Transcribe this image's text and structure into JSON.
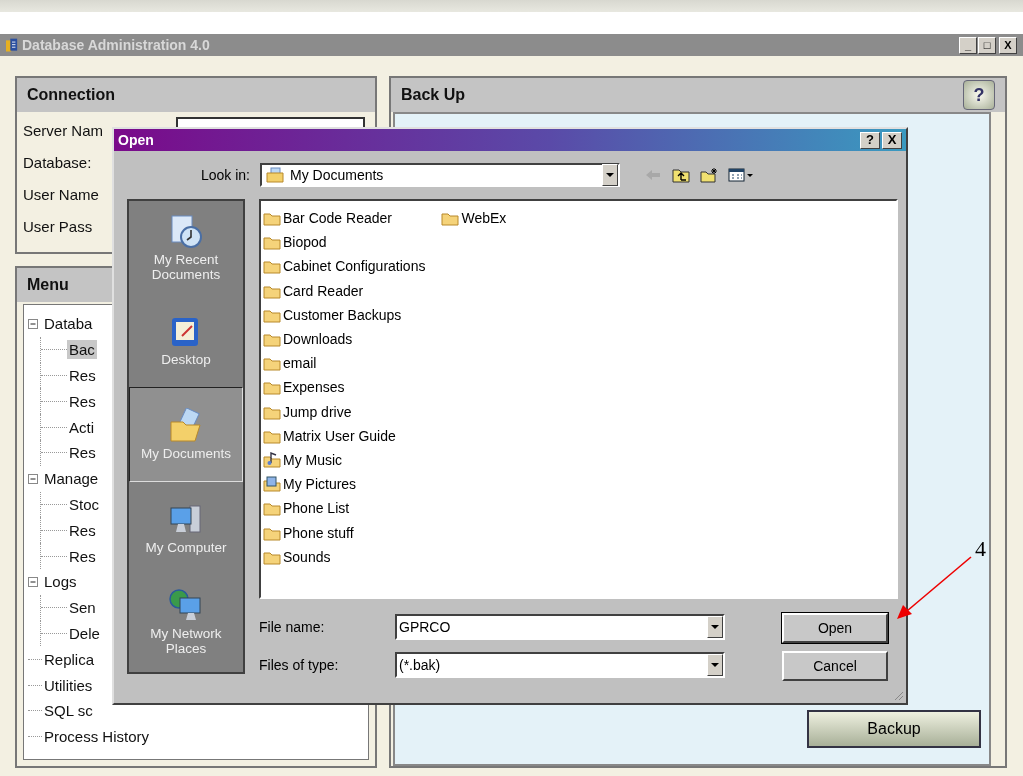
{
  "window": {
    "title": "Database Administration 4.0",
    "controls": [
      "_",
      "□",
      "X"
    ]
  },
  "connection": {
    "title": "Connection",
    "labels": [
      "Server Nam",
      "Database:",
      "User Name",
      "User Pass"
    ]
  },
  "menu": {
    "title": "Menu",
    "tree": [
      {
        "label": "Databa",
        "expanded": true,
        "selected": false,
        "children": [
          {
            "label": "Bac",
            "selected": true
          },
          {
            "label": "Res",
            "selected": false
          },
          {
            "label": "Res",
            "selected": false
          },
          {
            "label": "Acti",
            "selected": false
          },
          {
            "label": "Res",
            "selected": false
          }
        ]
      },
      {
        "label": "Manage",
        "expanded": true,
        "selected": false,
        "children": [
          {
            "label": "Stoc",
            "selected": false
          },
          {
            "label": "Res",
            "selected": false
          },
          {
            "label": "Res",
            "selected": false
          }
        ]
      },
      {
        "label": "Logs",
        "expanded": true,
        "selected": false,
        "children": [
          {
            "label": "Sen",
            "selected": false
          },
          {
            "label": "Dele",
            "selected": false
          }
        ]
      },
      {
        "label": "Replica",
        "selected": false
      },
      {
        "label": "Utilities",
        "selected": false
      },
      {
        "label": "SQL sc",
        "selected": false
      },
      {
        "label": "Process  History",
        "selected": false
      }
    ]
  },
  "backup": {
    "title": "Back Up",
    "help": "?",
    "button": "Backup"
  },
  "dialog": {
    "title": "Open",
    "controls": [
      "?",
      "X"
    ],
    "look_in_label": "Look in:",
    "look_in": "My Documents",
    "places": [
      {
        "label": "My Recent Documents",
        "kind": "recent",
        "selected": false
      },
      {
        "label": "Desktop",
        "kind": "desktop",
        "selected": false
      },
      {
        "label": "My Documents",
        "kind": "documents",
        "selected": true
      },
      {
        "label": "My Computer",
        "kind": "computer",
        "selected": false
      },
      {
        "label": "My Network Places",
        "kind": "network",
        "selected": false
      }
    ],
    "files": [
      {
        "name": "Bar Code Reader",
        "kind": "folder"
      },
      {
        "name": "Biopod",
        "kind": "folder"
      },
      {
        "name": "Cabinet Configurations",
        "kind": "folder"
      },
      {
        "name": "Card Reader",
        "kind": "folder"
      },
      {
        "name": "Customer Backups",
        "kind": "folder"
      },
      {
        "name": "Downloads",
        "kind": "folder"
      },
      {
        "name": "email",
        "kind": "folder"
      },
      {
        "name": "Expenses",
        "kind": "folder"
      },
      {
        "name": "Jump drive",
        "kind": "folder"
      },
      {
        "name": "Matrix User Guide",
        "kind": "folder"
      },
      {
        "name": "My Music",
        "kind": "music"
      },
      {
        "name": "My Pictures",
        "kind": "pictures"
      },
      {
        "name": "Phone List",
        "kind": "folder"
      },
      {
        "name": "Phone stuff",
        "kind": "folder"
      },
      {
        "name": "Sounds",
        "kind": "folder"
      },
      {
        "name": "WebEx",
        "kind": "folder"
      }
    ],
    "file_name_label": "File name:",
    "file_name": "GPRCO",
    "file_type_label": "Files of type:",
    "file_type": "(*.bak)",
    "buttons": [
      "Open",
      "Cancel"
    ]
  },
  "annotation": {
    "label": "4"
  }
}
